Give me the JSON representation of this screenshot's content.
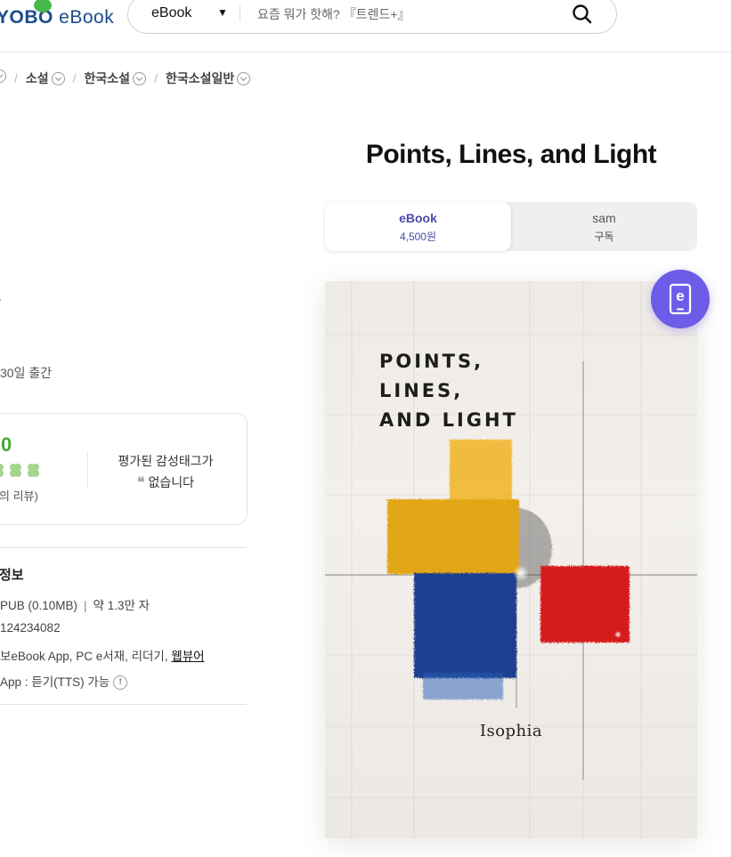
{
  "header": {
    "logo_brand": "YOBO",
    "logo_sub": " eBook",
    "search": {
      "selected_category": "eBook",
      "placeholder": "요즘 뭐가 핫해? 『트렌드+』"
    }
  },
  "breadcrumb": {
    "items": [
      {
        "label": "소설"
      },
      {
        "label": "한국소설"
      },
      {
        "label": "한국소설일반"
      }
    ],
    "separator": "/"
  },
  "product": {
    "title": "Points, Lines, and Light",
    "tabs": [
      {
        "label": "eBook",
        "sub": "4,500원",
        "selected": true
      },
      {
        "label": "sam",
        "sub": "구독",
        "selected": false
      }
    ],
    "cover": {
      "title": "POINTS,\nLINES,\nAND LIGHT",
      "author": "Isophia"
    },
    "ebook_badge_letter": "e"
  },
  "left_panel": {
    "side_mark": "·",
    "release": "30일 출간",
    "rating": {
      "score": "0",
      "review_count": "의 리뷰)",
      "tag_title": "평가된 감성태그가",
      "tag_none": "없습니다",
      "quote_mark": "❝"
    },
    "info": {
      "heading": "정보",
      "format": "PUB (0.10MB)",
      "separator": "|",
      "chars": "약 1.3만 자",
      "isbn": "124234082",
      "devices": "보eBook App, PC e서재, 리더기, ",
      "webviewer": "웹뷰어",
      "tts": "App : 듣기(TTS) 가능",
      "tts_icon": "!"
    }
  },
  "colors": {
    "brand_blue": "#1b4c8c",
    "tab_accent": "#4b4aa7",
    "badge": "#6c5ce7",
    "rating_green": "#47a82e"
  }
}
